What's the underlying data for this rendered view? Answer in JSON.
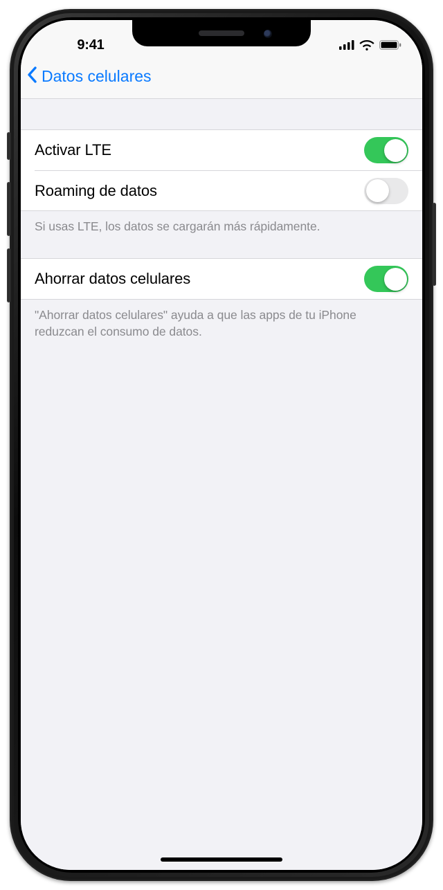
{
  "status": {
    "time": "9:41"
  },
  "nav": {
    "back_label": "Datos celulares"
  },
  "section1": {
    "rows": [
      {
        "label": "Activar LTE",
        "on": true
      },
      {
        "label": "Roaming de datos",
        "on": false
      }
    ],
    "footer": "Si usas LTE, los datos se cargarán más rápidamente."
  },
  "section2": {
    "rows": [
      {
        "label": "Ahorrar datos celulares",
        "on": true
      }
    ],
    "footer": "\"Ahorrar datos celulares\" ayuda a que las apps de tu iPhone reduzcan el consumo de datos."
  }
}
